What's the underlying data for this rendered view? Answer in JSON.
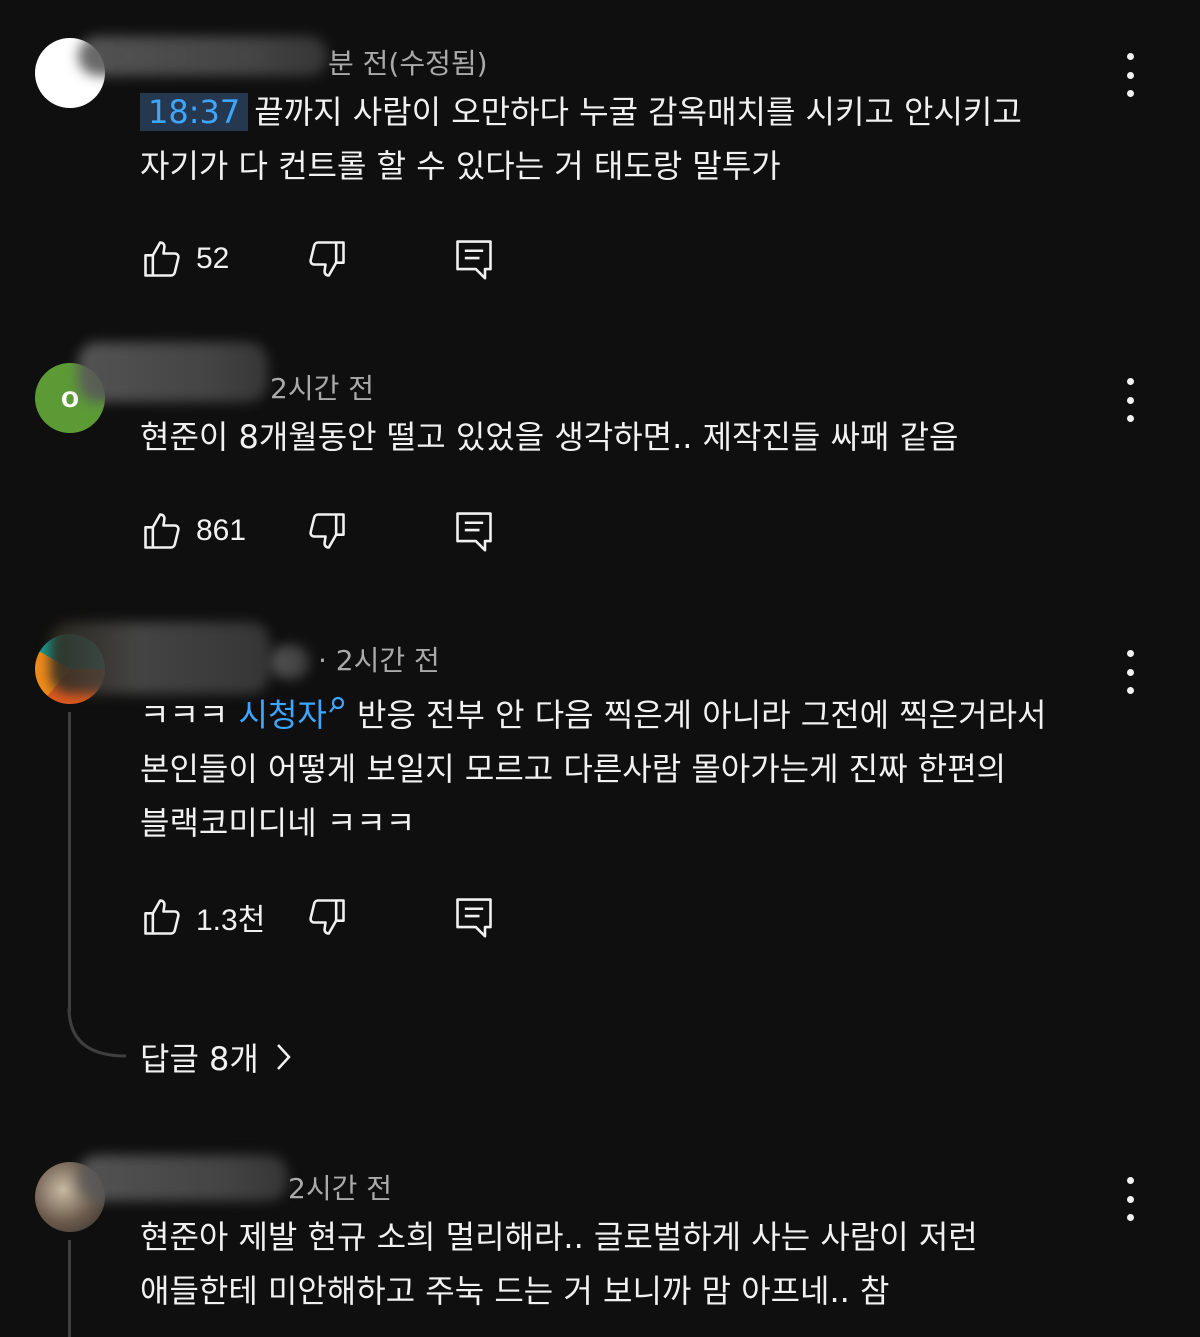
{
  "comments": [
    {
      "meta": "분 전(수정됨)",
      "timestamp": "18:37",
      "lines": [
        "끝까지 사람이 오만하다 누굴 감옥매치를 시키고 안시키고",
        "자기가 다 컨트롤 할 수 있다는 거 태도랑 말투가"
      ],
      "likes": "52"
    },
    {
      "avatar_letter": "o",
      "meta": "2시간 전",
      "lines": [
        "현준이 8개월동안 떨고 있었을 생각하면.. 제작진들 싸패 같음"
      ],
      "likes": "861"
    },
    {
      "meta": "· 2시간 전",
      "line1_prefix": "ㅋㅋㅋ ",
      "mention": "시청자",
      "line1_suffix": " 반응 전부 안 다음 찍은게 아니라 그전에 찍은거라서",
      "lines": [
        "본인들이 어떻게 보일지 모르고 다른사람 몰아가는게 진짜 한편의",
        "블랙코미디네 ㅋㅋㅋ"
      ],
      "likes": "1.3천",
      "replies": "답글 8개"
    },
    {
      "meta": "2시간 전",
      "lines": [
        "현준아 제발 현규 소희 멀리해라.. 글로벌하게 사는 사람이 저런",
        "애들한테 미안해하고 주눅 드는 거 보니까 맘 아프네.. 참"
      ]
    }
  ],
  "icons": {
    "like": "thumbs-up-icon",
    "dislike": "thumbs-down-icon",
    "reply": "reply-comment-icon",
    "more": "more-vert-icon",
    "chevron": "chevron-right-icon"
  },
  "colors": {
    "background": "#0f0f0f",
    "text": "#f1f1f1",
    "meta": "#aaaaaa",
    "link": "#3ea6ff",
    "timestamp_bg": "#263850",
    "avatar_green": "#5c9a36"
  }
}
